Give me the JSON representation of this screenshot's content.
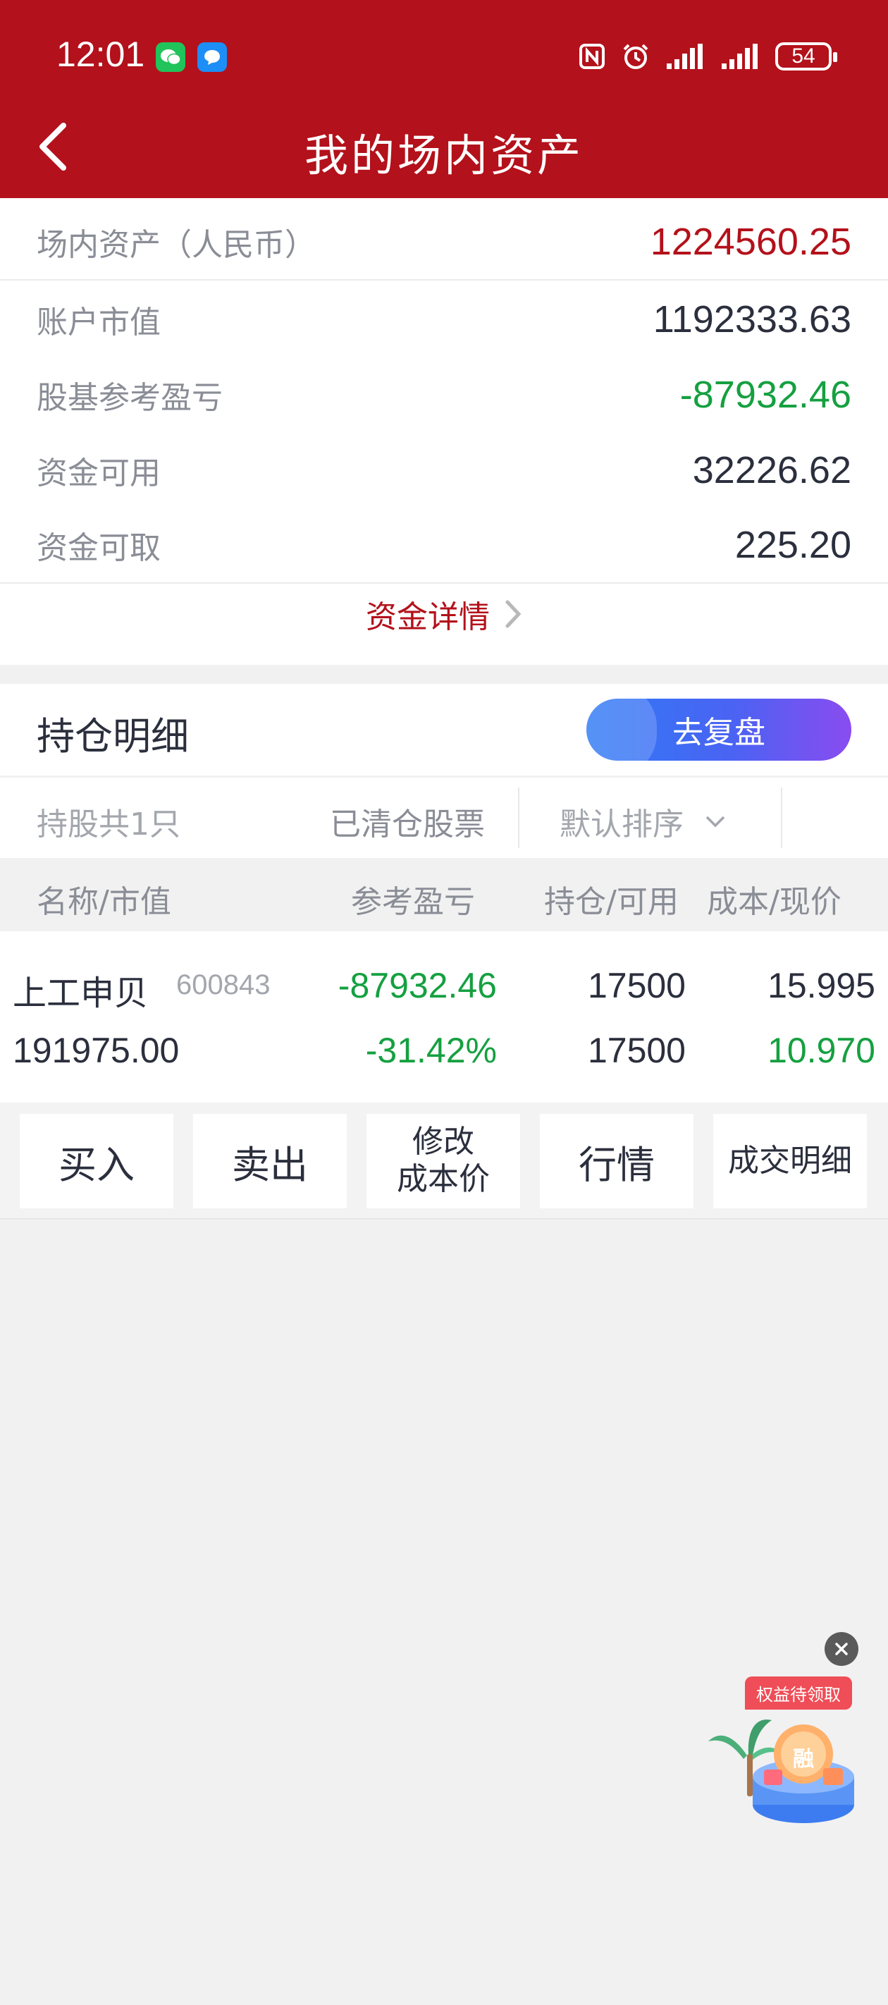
{
  "status_bar": {
    "time": "12:01",
    "battery": "54",
    "icons": [
      "wechat-icon",
      "message-icon",
      "nfc-icon",
      "alarm-icon",
      "signal-icon",
      "signal-icon",
      "battery-icon"
    ]
  },
  "header": {
    "title": "我的场内资产",
    "back_icon": "chevron-left-icon",
    "background": "#b3111b"
  },
  "assets": {
    "total_label": "场内资产（人民币）",
    "total_value": "1224560.25",
    "market_value_label": "账户市值",
    "market_value": "1192333.63",
    "pnl_label": "股基参考盈亏",
    "pnl_value": "-87932.46",
    "available_label": "资金可用",
    "available_value": "32226.62",
    "withdrawable_label": "资金可取",
    "withdrawable_value": "225.20",
    "detail_link": "资金详情"
  },
  "holdings": {
    "title": "持仓明细",
    "review_button": "去复盘",
    "count_label": "持股共1只",
    "cleared_label": "已清仓股票",
    "sort_label": "默认排序",
    "columns": [
      "名称/市值",
      "参考盈亏",
      "持仓/可用",
      "成本/现价"
    ],
    "rows": [
      {
        "name": "上工申贝",
        "code": "600843",
        "market_value": "191975.00",
        "pnl": "-87932.46",
        "pnl_pct": "-31.42%",
        "position": "17500",
        "available": "17500",
        "cost": "15.995",
        "price": "10.970"
      }
    ]
  },
  "actions": {
    "buy": "买入",
    "sell": "卖出",
    "modify_cost_line1": "修改",
    "modify_cost_line2": "成本价",
    "quote": "行情",
    "trade_detail": "成交明细"
  },
  "promo": {
    "tag": "权益待领取",
    "badge_text": "融",
    "close_icon": "close-icon"
  },
  "colors": {
    "brand_red": "#b3111b",
    "loss_green": "#15a040",
    "review_gradient_start": "#2f7bf4",
    "review_gradient_end": "#8a4cf0"
  }
}
